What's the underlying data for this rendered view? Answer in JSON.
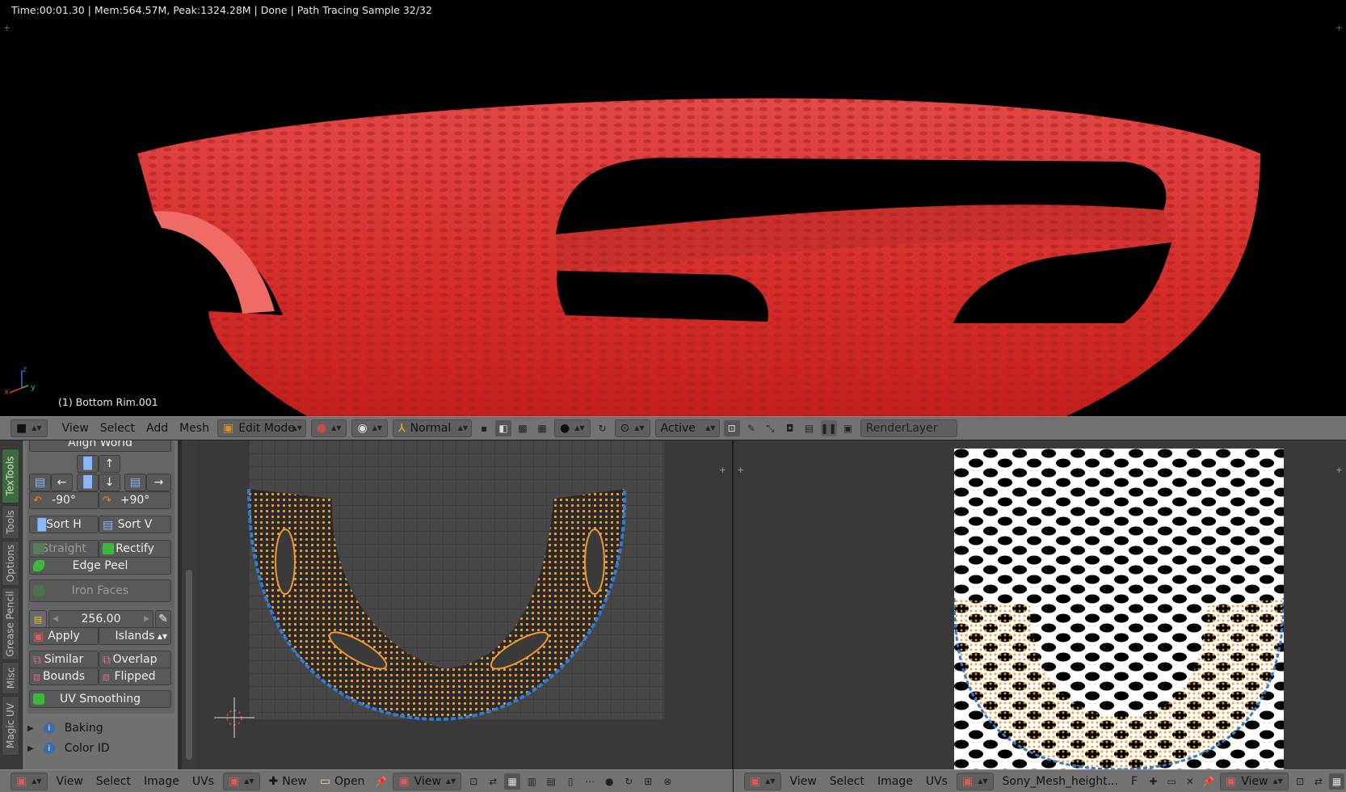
{
  "render": {
    "status": "Time:00:01.30 | Mem:564.57M, Peak:1324.28M | Done | Path Tracing Sample 32/32",
    "object_label": "(1) Bottom Rim.001",
    "axis_x": "x",
    "axis_y": "y",
    "axis_z": "z"
  },
  "header3d": {
    "view": "View",
    "select": "Select",
    "add": "Add",
    "mesh": "Mesh",
    "mode": "Edit Mode",
    "orientation": "Normal",
    "pivot_mode": "Active",
    "render_layer": "RenderLayer"
  },
  "tabs": [
    "TexTools",
    "Tools",
    "Options",
    "Grease Pencil",
    "Misc",
    "Magic UV"
  ],
  "toolshelf": {
    "align_world": "Align World",
    "rot_neg": "-90°",
    "rot_pos": "+90°",
    "sort_h": "Sort H",
    "sort_v": "Sort V",
    "straight": "Straight",
    "rectify": "Rectify",
    "edge_peel": "Edge Peel",
    "iron_faces": "Iron Faces",
    "texel_value": "256.00",
    "apply": "Apply",
    "islands": "Islands",
    "similar": "Similar",
    "overlap": "Overlap",
    "bounds": "Bounds",
    "flipped": "Flipped",
    "uv_smoothing": "UV Smoothing",
    "baking": "Baking",
    "color_id": "Color ID"
  },
  "footer_left": {
    "view": "View",
    "select": "Select",
    "image": "Image",
    "uvs": "UVs",
    "new": "New",
    "open": "Open",
    "view2": "View"
  },
  "footer_right": {
    "view": "View",
    "select": "Select",
    "image": "Image",
    "uvs": "UVs",
    "image_name": "Sony_Mesh_height...",
    "f_label": "F",
    "view2": "View"
  },
  "colors": {
    "uv_edge_orange": "#f39a2d",
    "uv_edge_blue": "#2f7bd6",
    "mesh_red": "#e0322f",
    "tab_active_green": "#3e6b3e"
  }
}
